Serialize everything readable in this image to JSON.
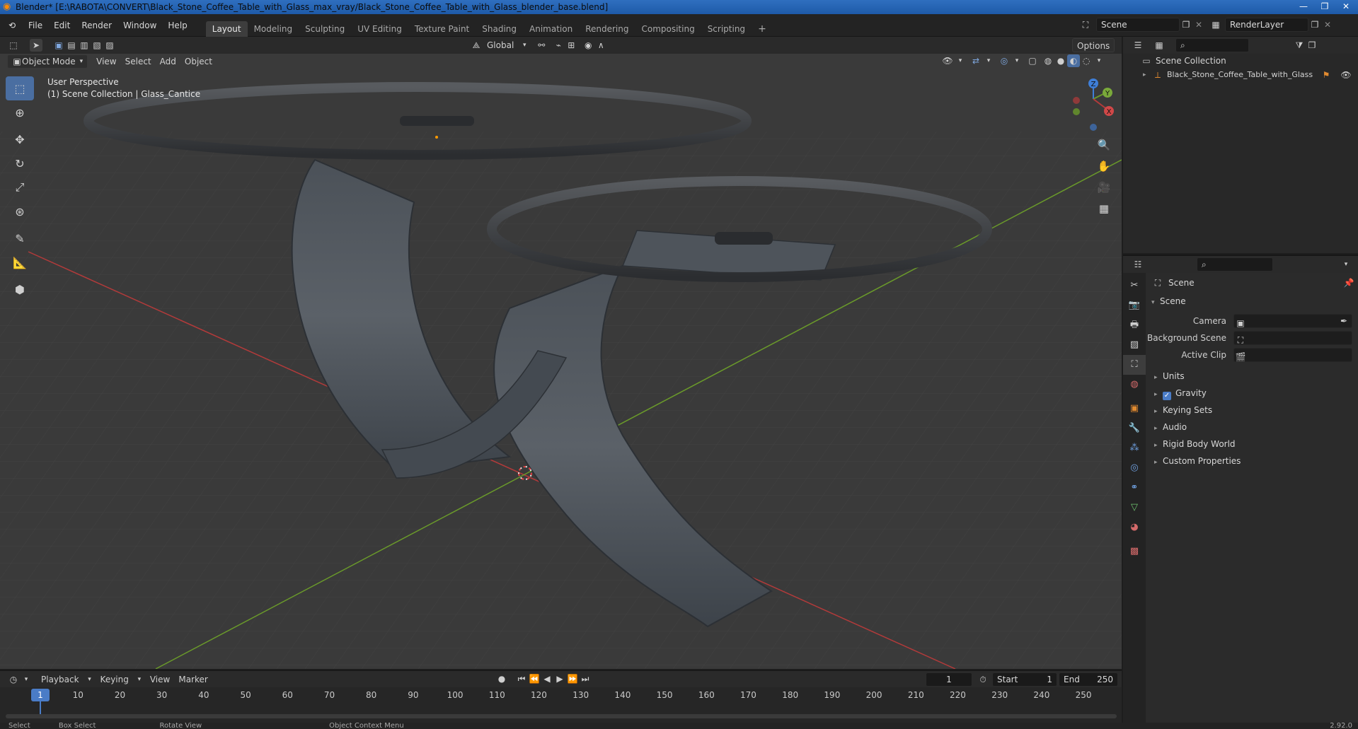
{
  "window": {
    "title": "Blender* [E:\\RABOTA\\CONVERT\\Black_Stone_Coffee_Table_with_Glass_max_vray/Black_Stone_Coffee_Table_with_Glass_blender_base.blend]"
  },
  "menu": {
    "items": [
      "File",
      "Edit",
      "Render",
      "Window",
      "Help"
    ]
  },
  "workspaces": {
    "tabs": [
      "Layout",
      "Modeling",
      "Sculpting",
      "UV Editing",
      "Texture Paint",
      "Shading",
      "Animation",
      "Rendering",
      "Compositing",
      "Scripting"
    ],
    "active": "Layout"
  },
  "scene_selector": {
    "value": "Scene"
  },
  "view_layer": {
    "value": "RenderLayer"
  },
  "viewport_header": {
    "transform_orientation": "Global",
    "options_label": "Options"
  },
  "viewport_subheader": {
    "mode": "Object Mode",
    "menus": [
      "View",
      "Select",
      "Add",
      "Object"
    ]
  },
  "viewport": {
    "perspective_label": "User Perspective",
    "collection_label": "(1) Scene Collection | Glass_Cantice",
    "gizmo_axes": {
      "z": "Z",
      "y": "Y",
      "x": "X"
    }
  },
  "timeline": {
    "menus": [
      "Playback",
      "Keying",
      "View",
      "Marker"
    ],
    "current_frame": "1",
    "start_label": "Start",
    "start_value": "1",
    "end_label": "End",
    "end_value": "250",
    "ticks": [
      "1",
      "10",
      "20",
      "30",
      "40",
      "50",
      "60",
      "70",
      "80",
      "90",
      "100",
      "110",
      "120",
      "130",
      "140",
      "150",
      "160",
      "170",
      "180",
      "190",
      "200",
      "210",
      "220",
      "230",
      "240",
      "250"
    ]
  },
  "status_bar": {
    "items": [
      "Select",
      "Box Select",
      "Rotate View",
      "Object Context Menu"
    ],
    "version": "2.92.0"
  },
  "outliner": {
    "root": "Scene Collection",
    "items": [
      "Black_Stone_Coffee_Table_with_Glass"
    ]
  },
  "properties": {
    "context_title": "Scene",
    "panel_title": "Scene",
    "fields": [
      {
        "label": "Camera"
      },
      {
        "label": "Background Scene"
      },
      {
        "label": "Active Clip"
      }
    ],
    "panels": [
      "Units",
      "Gravity",
      "Keying Sets",
      "Audio",
      "Rigid Body World",
      "Custom Properties"
    ],
    "gravity_checked": true
  },
  "colors": {
    "accent": "#4a7cc7",
    "x_axis": "#b33a3a",
    "y_axis": "#6a9a2a",
    "z_axis": "#3f7fd8"
  }
}
